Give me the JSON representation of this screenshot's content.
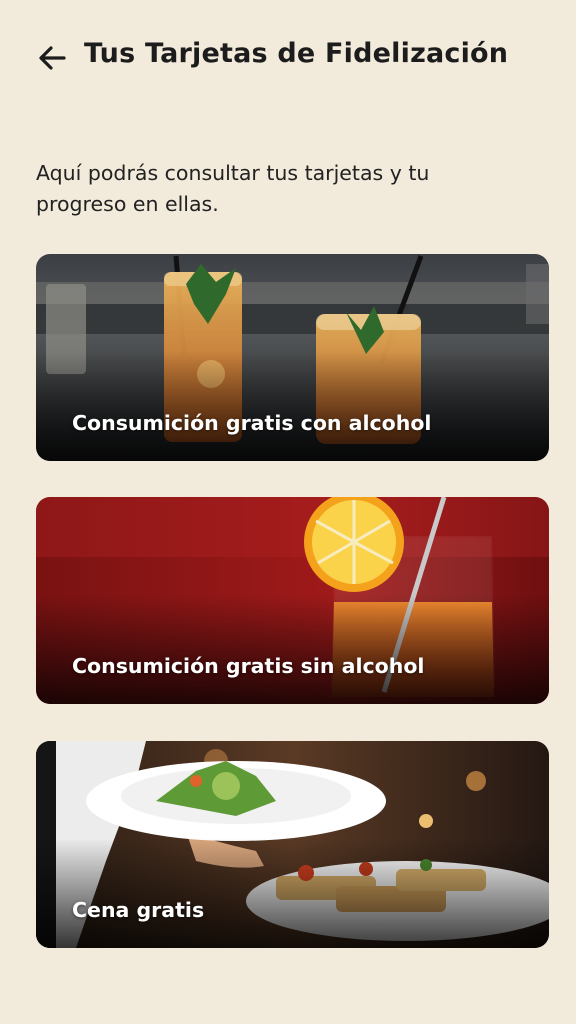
{
  "header": {
    "back_icon": "arrow-left-icon",
    "title": "Tus Tarjetas de Fidelización"
  },
  "intro": {
    "text": "Aquí podrás consultar tus tarjetas y tu progreso en ellas."
  },
  "cards": [
    {
      "label": "Consumición gratis con alcohol",
      "image": "cocktails-with-straws"
    },
    {
      "label": "Consumición gratis sin alcohol",
      "image": "orange-drink-red-background"
    },
    {
      "label": "Cena gratis",
      "image": "waiter-serving-plates"
    }
  ],
  "colors": {
    "background": "#f2eadb",
    "text": "#1c1c1c",
    "card_label": "#ffffff"
  }
}
